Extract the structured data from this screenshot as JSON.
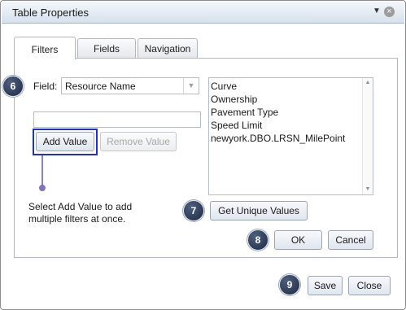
{
  "dialog": {
    "title": "Table Properties",
    "menu_icon": "dropdown-triangle",
    "close_icon": "close-circle"
  },
  "tabs": [
    {
      "label": "Filters",
      "active": true
    },
    {
      "label": "Fields",
      "active": false
    },
    {
      "label": "Navigation",
      "active": false
    }
  ],
  "filters": {
    "field_label": "Field:",
    "field_value": "Resource Name",
    "value_input": "",
    "add_value_label": "Add Value",
    "remove_value_label": "Remove Value",
    "values_list": [
      "Curve",
      "Ownership",
      "Pavement Type",
      "Speed Limit",
      "newyork.DBO.LRSN_MilePoint"
    ],
    "get_unique_label": "Get Unique Values",
    "ok_label": "OK",
    "cancel_label": "Cancel"
  },
  "footer": {
    "save_label": "Save",
    "close_label": "Close"
  },
  "callouts": {
    "step6": "6",
    "step7": "7",
    "step8": "8",
    "step9": "9",
    "add_value_note": "Select Add Value to add multiple filters at once."
  },
  "colors": {
    "highlight_border": "#1f2fd0",
    "badge_fill": "#1c2a44",
    "connector": "#8a80c8"
  }
}
